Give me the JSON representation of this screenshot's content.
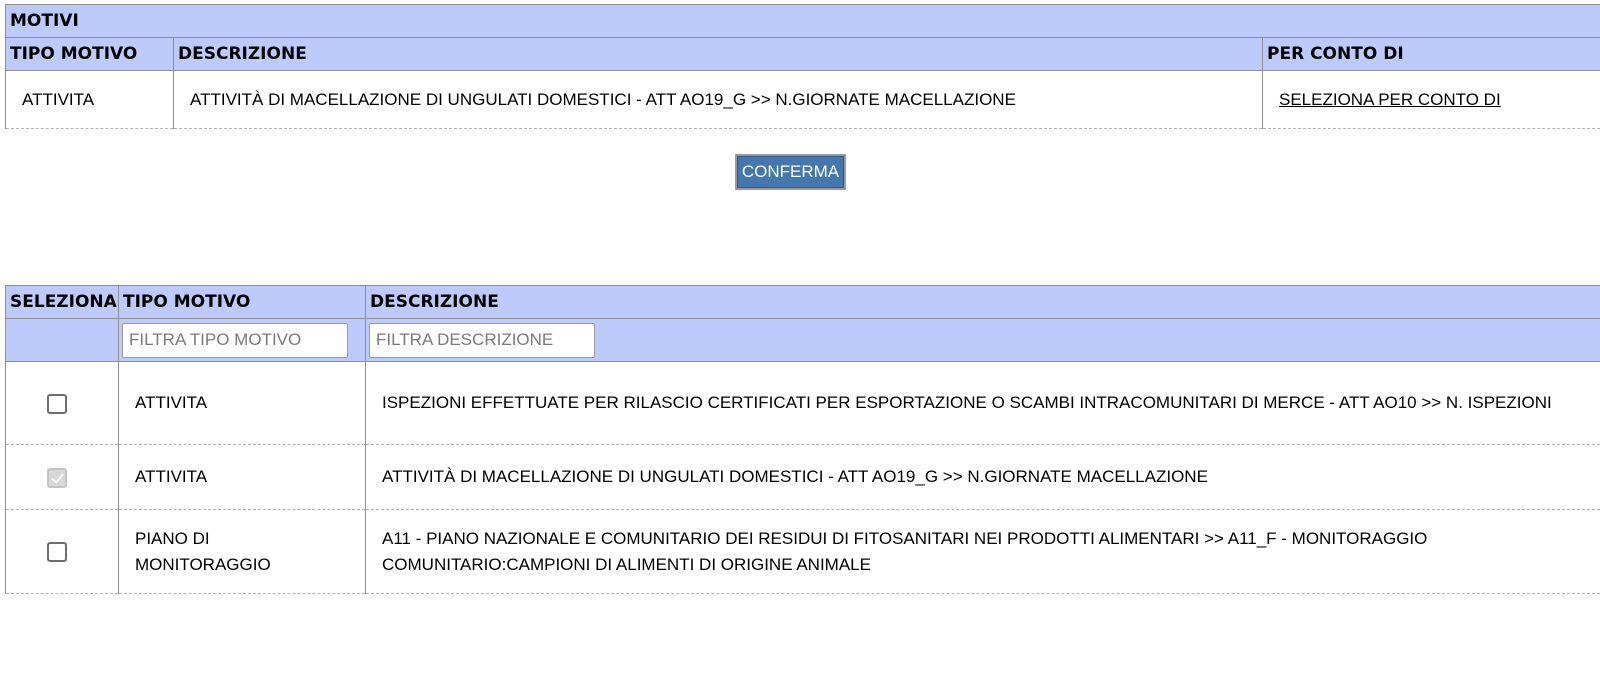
{
  "motivi": {
    "title": "MOTIVI",
    "headers": {
      "tipo_motivo": "TIPO MOTIVO",
      "descrizione": "DESCRIZIONE",
      "per_conto_di": "PER CONTO DI"
    },
    "rows": [
      {
        "tipo": "ATTIVITA",
        "descrizione": "ATTIVITÀ DI MACELLAZIONE DI UNGULATI DOMESTICI - ATT AO19_G >> N.GIORNATE MACELLAZIONE",
        "per_conto_link": "SELEZIONA PER CONTO DI"
      }
    ]
  },
  "confirm_label": "CONFERMA",
  "selection": {
    "headers": {
      "seleziona": "SELEZIONA",
      "tipo_motivo": "TIPO MOTIVO",
      "descrizione": "DESCRIZIONE"
    },
    "filters": {
      "tipo_placeholder": "FILTRA TIPO MOTIVO",
      "descrizione_placeholder": "FILTRA DESCRIZIONE"
    },
    "rows": [
      {
        "checked": false,
        "tipo": "ATTIVITA",
        "descrizione": "ISPEZIONI EFFETTUATE PER RILASCIO CERTIFICATI PER ESPORTAZIONE O SCAMBI INTRACOMUNITARI DI MERCE - ATT AO10 >> N. ISPEZIONI"
      },
      {
        "checked": true,
        "tipo": "ATTIVITA",
        "descrizione": "ATTIVITÀ DI MACELLAZIONE DI UNGULATI DOMESTICI - ATT AO19_G >> N.GIORNATE MACELLAZIONE"
      },
      {
        "checked": false,
        "tipo": "PIANO DI MONITORAGGIO",
        "descrizione": "A11 - PIANO NAZIONALE E COMUNITARIO DEI RESIDUI DI FITOSANITARI NEI PRODOTTI ALIMENTARI >> A11_F - MONITORAGGIO COMUNITARIO:CAMPIONI DI ALIMENTI DI ORIGINE ANIMALE"
      }
    ]
  },
  "colors": {
    "header_bg": "#bccbfc",
    "button_bg": "#4477ad",
    "border": "#8f8f8f"
  }
}
